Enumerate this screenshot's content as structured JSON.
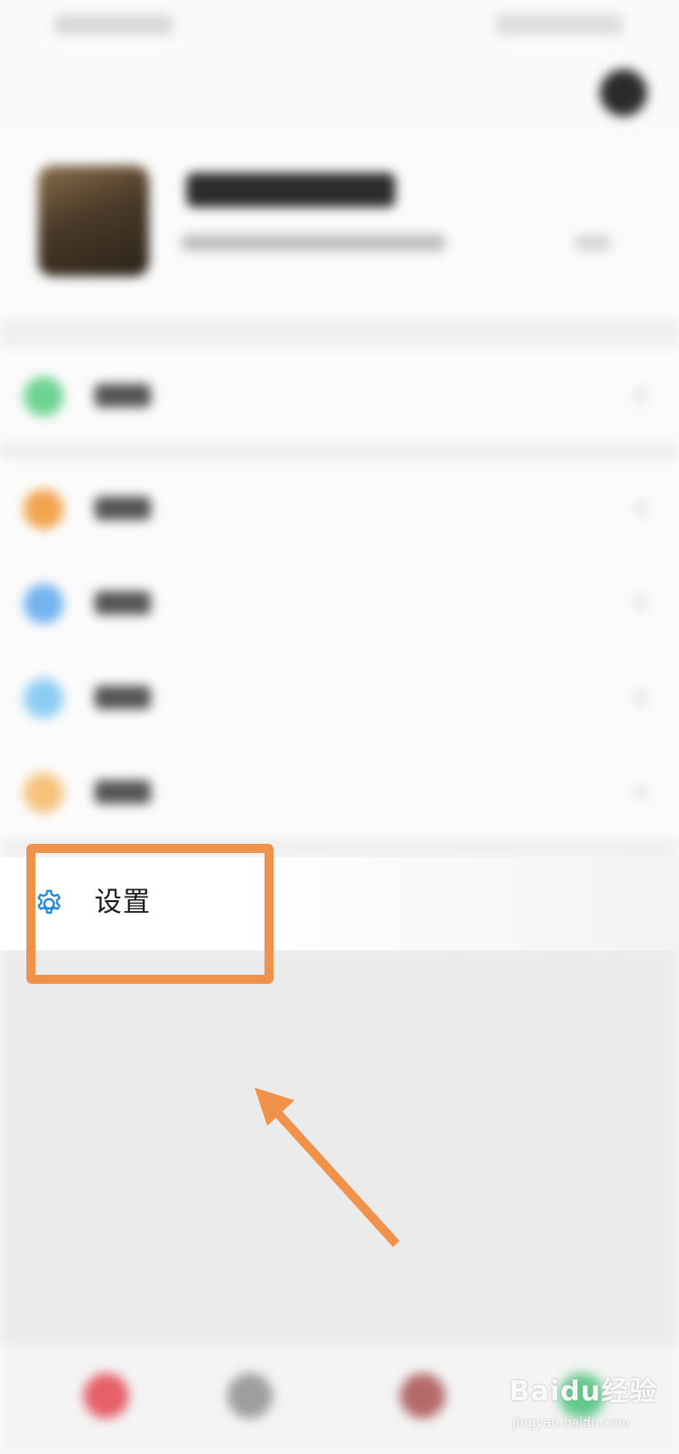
{
  "settings_item": {
    "label": "设置",
    "icon": "gear-icon"
  },
  "colors": {
    "accent_annotation": "#f0924a",
    "settings_icon": "#1e88e5",
    "row_icon_green": "#6fd493",
    "row_icon_orange": "#f2a44f",
    "row_icon_blue": "#74b3f0",
    "row_icon_lightblue": "#8ecdf3",
    "row_icon_yellow": "#f6c27a"
  },
  "watermark": {
    "brand": "Baidu经验",
    "url": "jingyan.baidu.com"
  }
}
